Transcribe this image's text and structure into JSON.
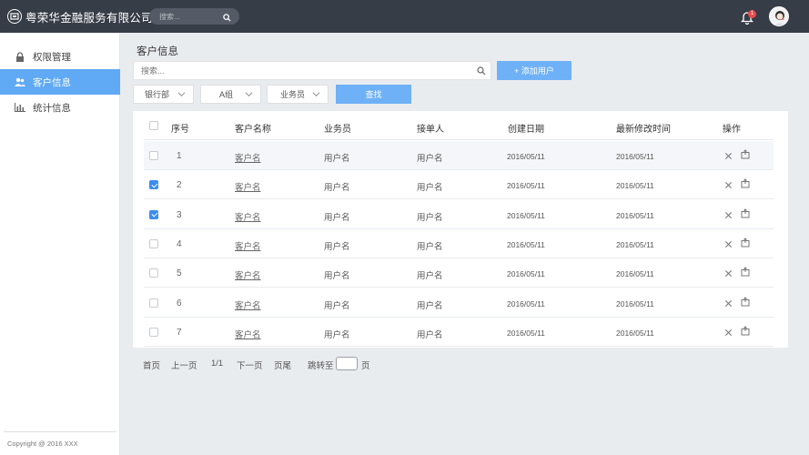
{
  "app": {
    "title": "粤荣华金融服务有限公司"
  },
  "topbar": {
    "search_placeholder": "搜索...",
    "notification_count": "1"
  },
  "sidebar": {
    "items": [
      {
        "label": "权限管理",
        "icon": "lock-icon",
        "active": false
      },
      {
        "label": "客户信息",
        "icon": "users-icon",
        "active": true
      },
      {
        "label": "统计信息",
        "icon": "bar-chart-icon",
        "active": false
      }
    ],
    "copyright": "Copyright @ 2016 XXX"
  },
  "main": {
    "title": "客户信息",
    "search_placeholder": "搜索...",
    "add_button": "+ 添加用户",
    "filters": [
      "银行部",
      "A组",
      "业务员"
    ],
    "find_button": "查找"
  },
  "table": {
    "headers": [
      "序号",
      "客户名称",
      "业务员",
      "接单人",
      "创建日期",
      "最新修改时间",
      "操作"
    ],
    "rows": [
      {
        "checked": false,
        "no": "1",
        "name": "客户名",
        "sales": "用户名",
        "taker": "用户名",
        "created": "2016/05/11",
        "modified": "2016/05/11"
      },
      {
        "checked": true,
        "no": "2",
        "name": "客户名",
        "sales": "用户名",
        "taker": "用户名",
        "created": "2016/05/11",
        "modified": "2016/05/11"
      },
      {
        "checked": true,
        "no": "3",
        "name": "客户名",
        "sales": "用户名",
        "taker": "用户名",
        "created": "2016/05/11",
        "modified": "2016/05/11"
      },
      {
        "checked": false,
        "no": "4",
        "name": "客户名",
        "sales": "用户名",
        "taker": "用户名",
        "created": "2016/05/11",
        "modified": "2016/05/11"
      },
      {
        "checked": false,
        "no": "5",
        "name": "客户名",
        "sales": "用户名",
        "taker": "用户名",
        "created": "2016/05/11",
        "modified": "2016/05/11"
      },
      {
        "checked": false,
        "no": "6",
        "name": "客户名",
        "sales": "用户名",
        "taker": "用户名",
        "created": "2016/05/11",
        "modified": "2016/05/11"
      },
      {
        "checked": false,
        "no": "7",
        "name": "客户名",
        "sales": "用户名",
        "taker": "用户名",
        "created": "2016/05/11",
        "modified": "2016/05/11"
      }
    ]
  },
  "pagination": {
    "first": "首页",
    "prev": "上一页",
    "current": "1/1",
    "next": "下一页",
    "last": "页尾",
    "jump_label": "跳转至",
    "page_suffix": "页"
  },
  "colors": {
    "topbar": "#373d47",
    "accent": "#5fa9f5",
    "button": "#6fb1f6",
    "badge": "#ea4b4b",
    "checkbox": "#3d8cef"
  }
}
